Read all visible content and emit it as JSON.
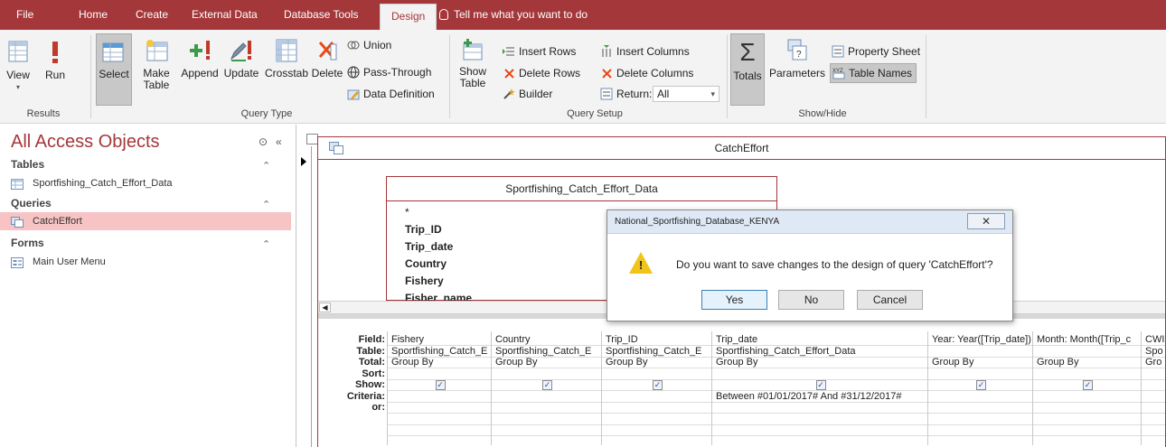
{
  "tabs": {
    "file": "File",
    "home": "Home",
    "create": "Create",
    "external": "External Data",
    "dbtools": "Database Tools",
    "design": "Design",
    "tell": "Tell me what you want to do"
  },
  "ribbon": {
    "results": {
      "view": "View",
      "run": "Run",
      "label": "Results"
    },
    "query_type": {
      "select": "Select",
      "make_table_1": "Make",
      "make_table_2": "Table",
      "append": "Append",
      "update": "Update",
      "crosstab": "Crosstab",
      "delete": "Delete",
      "union": "Union",
      "pass_through": "Pass-Through",
      "data_definition": "Data Definition",
      "label": "Query Type"
    },
    "query_setup": {
      "show_table_1": "Show",
      "show_table_2": "Table",
      "insert_rows": "Insert Rows",
      "delete_rows": "Delete Rows",
      "builder": "Builder",
      "insert_columns": "Insert Columns",
      "delete_columns": "Delete Columns",
      "return_label": "Return:",
      "return_value": "All",
      "label": "Query Setup"
    },
    "show_hide": {
      "totals": "Totals",
      "parameters": "Parameters",
      "property_sheet": "Property Sheet",
      "table_names": "Table Names",
      "label": "Show/Hide"
    }
  },
  "nav": {
    "title": "All Access Objects",
    "sections": {
      "tables": "Tables",
      "queries": "Queries",
      "forms": "Forms"
    },
    "items": {
      "table1": "Sportfishing_Catch_Effort_Data",
      "query1": "CatchEffort",
      "form1": "Main User Menu"
    }
  },
  "query": {
    "window_title": "CatchEffort",
    "table_box_title": "Sportfishing_Catch_Effort_Data",
    "table_fields": [
      "*",
      "Trip_ID",
      "Trip_date",
      "Country",
      "Fishery",
      "Fisher_name"
    ],
    "row_labels": [
      "Field:",
      "Table:",
      "Total:",
      "Sort:",
      "Show:",
      "Criteria:",
      "or:"
    ],
    "columns": [
      {
        "field": "Fishery",
        "table": "Sportfishing_Catch_E",
        "total": "Group By",
        "show": true,
        "criteria": ""
      },
      {
        "field": "Country",
        "table": "Sportfishing_Catch_E",
        "total": "Group By",
        "show": true,
        "criteria": ""
      },
      {
        "field": "Trip_ID",
        "table": "Sportfishing_Catch_E",
        "total": "Group By",
        "show": true,
        "criteria": ""
      },
      {
        "field": "Trip_date",
        "table": "Sportfishing_Catch_Effort_Data",
        "total": "Group By",
        "show": true,
        "criteria": "Between #01/01/2017# And #31/12/2017#"
      },
      {
        "field": "Year: Year([Trip_date])",
        "table": "",
        "total": "Group By",
        "show": true,
        "criteria": ""
      },
      {
        "field": "Month: Month([Trip_c",
        "table": "",
        "total": "Group By",
        "show": true,
        "criteria": ""
      },
      {
        "field": "CWI",
        "table": "Spo",
        "total": "Gro",
        "show": false,
        "criteria": ""
      }
    ]
  },
  "dialog": {
    "title": "National_Sportfishing_Database_KENYA",
    "close": "✕",
    "message": "Do you want to save changes to the design of query 'CatchEffort'?",
    "yes": "Yes",
    "no": "No",
    "cancel": "Cancel"
  },
  "colors": {
    "brand": "#a4373a",
    "ribbon_bg": "#f3f3f3",
    "selected_nav": "#f7c3c4"
  }
}
